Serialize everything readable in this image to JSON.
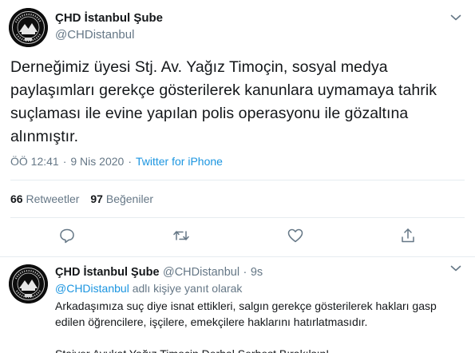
{
  "main_tweet": {
    "display_name": "ÇHD İstanbul Şube",
    "handle": "@CHDistanbul",
    "text": "Derneğimiz üyesi Stj. Av. Yağız Timoçin, sosyal medya paylaşımları gerekçe gösterilerek kanunlara uymamaya tahrik suçlaması ile evine yapılan polis operasyonu ile gözaltına alınmıştır.",
    "time": "ÖÖ 12:41",
    "date": "9 Nis 2020",
    "separator": "·",
    "source": "Twitter for iPhone",
    "retweets_count": "66",
    "retweets_label": "Retweetler",
    "likes_count": "97",
    "likes_label": "Beğeniler"
  },
  "actions": {
    "reply_icon": "reply-icon",
    "retweet_icon": "retweet-icon",
    "like_icon": "heart-icon",
    "share_icon": "share-icon"
  },
  "reply_tweet": {
    "display_name": "ÇHD İstanbul Şube",
    "handle": "@CHDistanbul",
    "separator": "·",
    "time_ago": "9s",
    "replying_to_handle": "@CHDistanbul",
    "replying_to_suffix": "adlı kişiye yanıt olarak",
    "line1": "Arkadaşımıza suç diye isnat ettikleri, salgın gerekçe gösterilerek hakları gasp edilen öğrencilere, işçilere, emekçilere haklarını hatırlatmasıdır.",
    "line2": "Stajyer Avukat Yağız Timoçin Derhal Serbest Bırakılsın!"
  },
  "colors": {
    "link": "#1b95e0",
    "secondary_text": "#657786",
    "primary_text": "#14171a",
    "divider": "#e6ecf0"
  }
}
